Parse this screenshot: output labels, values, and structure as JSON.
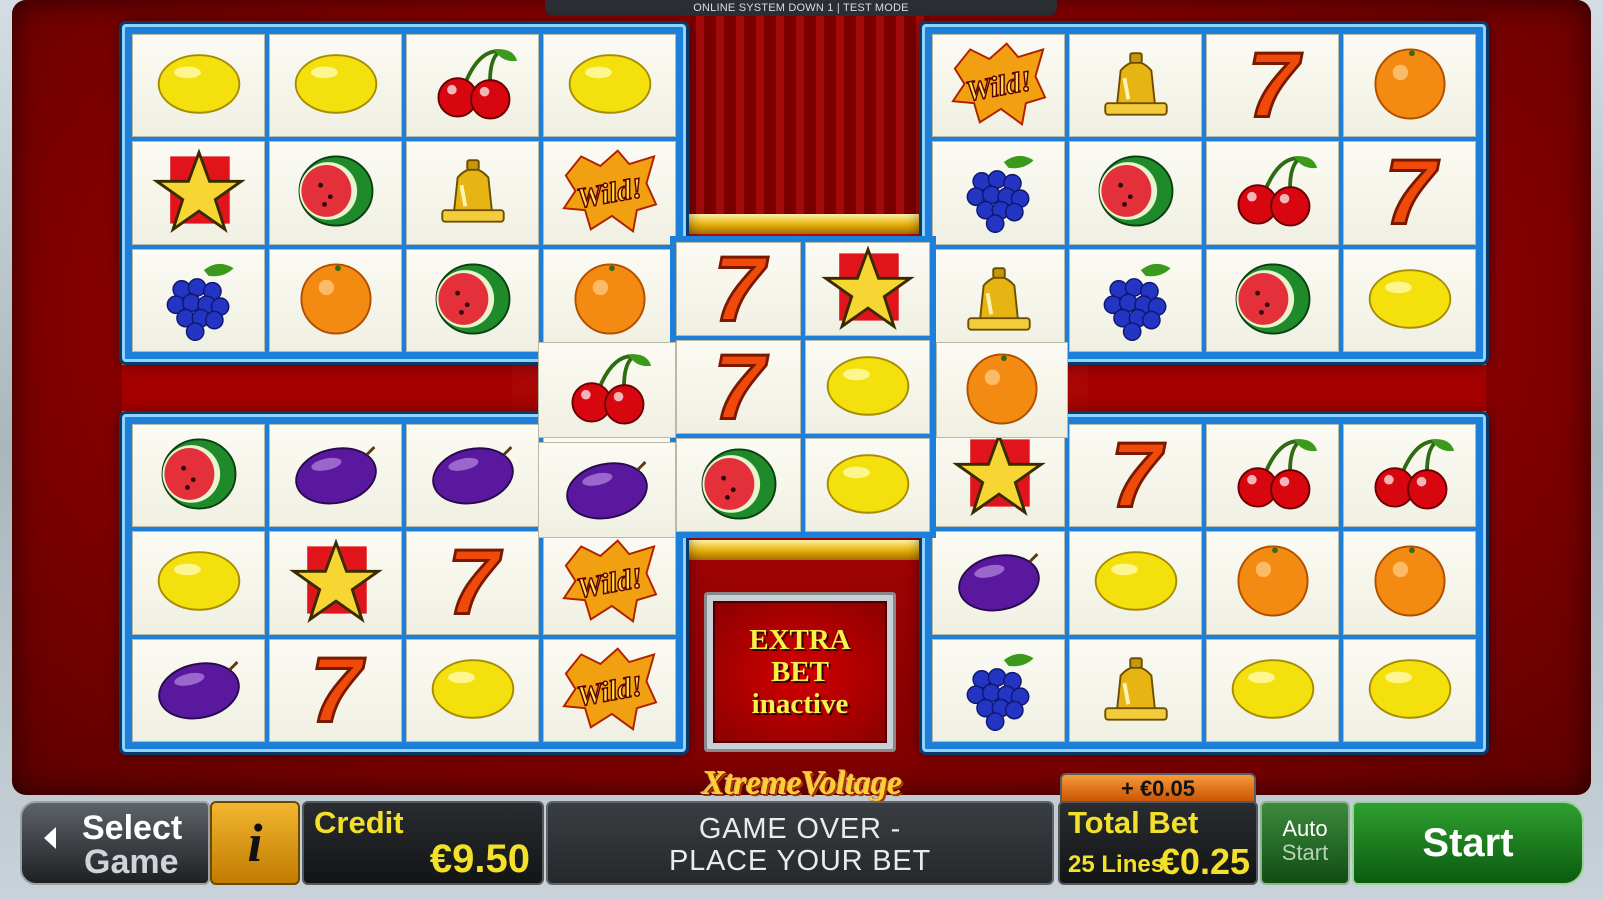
{
  "status_bar": {
    "text": "ONLINE SYSTEM DOWN 1 | TEST MODE"
  },
  "reels": {
    "top_left": [
      [
        "lemon",
        "lemon",
        "cherry",
        "lemon"
      ],
      [
        "star",
        "watermelon",
        "bell",
        "wild"
      ],
      [
        "grapes",
        "orange",
        "watermelon",
        "orange"
      ]
    ],
    "top_right": [
      [
        "wild",
        "bell",
        "seven",
        "orange"
      ],
      [
        "grapes",
        "watermelon",
        "cherry",
        "seven"
      ],
      [
        "bell",
        "grapes",
        "watermelon",
        "lemon"
      ]
    ],
    "bottom_left": [
      [
        "watermelon",
        "plum",
        "plum",
        "plum"
      ],
      [
        "lemon",
        "star",
        "seven",
        "wild"
      ],
      [
        "plum",
        "seven",
        "lemon",
        "wild"
      ]
    ],
    "bottom_right": [
      [
        "star",
        "seven",
        "cherry",
        "cherry"
      ],
      [
        "plum",
        "lemon",
        "orange",
        "orange"
      ],
      [
        "grapes",
        "bell",
        "lemon",
        "lemon"
      ]
    ],
    "center": [
      [
        "seven",
        "star"
      ],
      [
        "seven",
        "lemon"
      ],
      [
        "watermelon",
        "lemon"
      ]
    ],
    "connector_left": [
      "cherry",
      "plum"
    ],
    "connector_right": [
      "orange"
    ]
  },
  "extra_bet": {
    "line1": "EXTRA",
    "line2": "BET",
    "line3": "inactive"
  },
  "logo": {
    "text": "XtremeVoltage"
  },
  "controls": {
    "select_game_line1": "Select",
    "select_game_line2": "Game",
    "info_label": "i",
    "credit_label": "Credit",
    "credit_value": "€9.50",
    "message_line1": "GAME OVER -",
    "message_line2": "PLACE YOUR BET",
    "extra_bet_add": "+ €0.05",
    "total_bet_label": "Total Bet",
    "lines_label": "25 Lines",
    "total_bet_value": "€0.25",
    "auto_start_line1": "Auto",
    "auto_start_line2": "Start",
    "start_label": "Start"
  },
  "wild_text": "Wild!",
  "seven_text": "7",
  "colors": {
    "accent_gold": "#f3e02a",
    "reel_frame": "#1c7fd9",
    "cabinet_red": "#c40b0b",
    "start_green": "#2ea02e"
  }
}
